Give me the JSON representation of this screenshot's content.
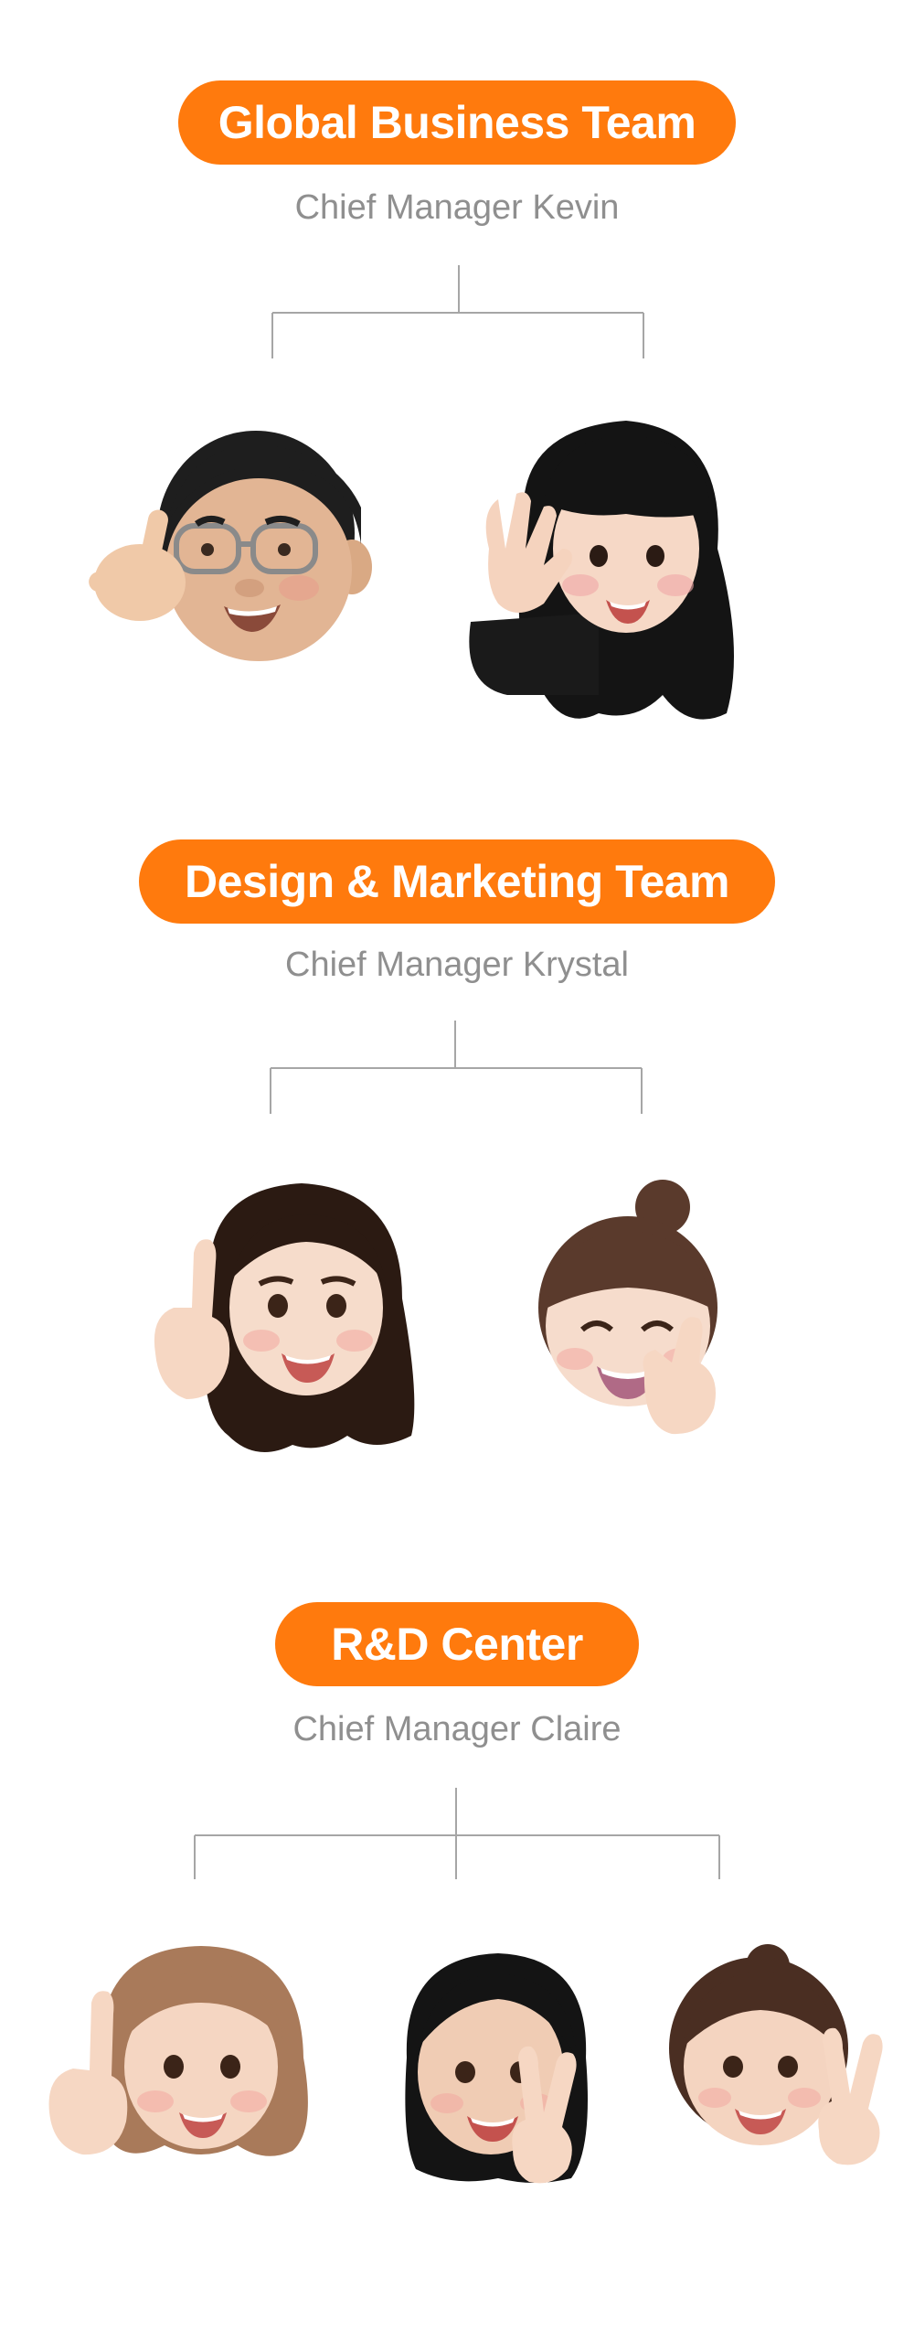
{
  "teams": [
    {
      "name": "Global Business Team",
      "manager": "Chief Manager Kevin"
    },
    {
      "name": "Design & Marketing Team",
      "manager": "Chief Manager Krystal"
    },
    {
      "name": "R&D Center",
      "manager": "Chief Manager Claire"
    }
  ],
  "colors": {
    "accent": "#ff7a0d",
    "manager_text": "#8f8f8f",
    "connector": "#a6a6a6"
  },
  "icons": [
    "memoji-avatar-glasses-man-shaka",
    "memoji-avatar-bangs-woman-wave",
    "memoji-avatar-long-hair-woman-point",
    "memoji-avatar-bun-woman-crossed-fingers",
    "memoji-avatar-light-brown-hair-woman-point",
    "memoji-avatar-black-hair-woman-peace",
    "memoji-avatar-brown-hair-woman-peace"
  ]
}
